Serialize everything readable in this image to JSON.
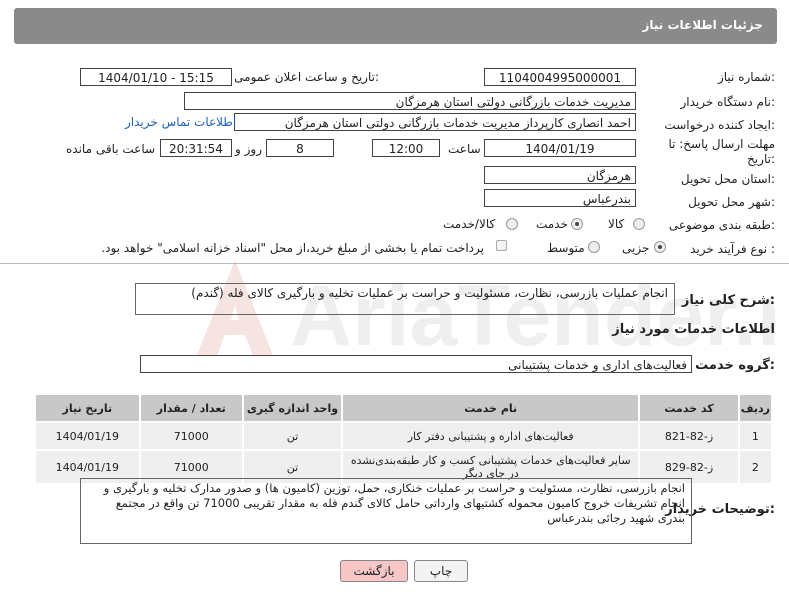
{
  "header": {
    "title": "جزئیات اطلاعات نیاز"
  },
  "fields": {
    "need_number_label": "شماره نیاز:",
    "need_number": "1104004995000001",
    "announce_label": "تاریخ و ساعت اعلان عمومی:",
    "announce_value": "1404/01/10 - 15:15",
    "buyer_label": "نام دستگاه خریدار:",
    "buyer_value": "مدیریت خدمات بازرگانی دولتی استان هرمزگان",
    "creator_label": "ایجاد کننده درخواست:",
    "creator_value": "احمد انصاری کارپرداز مدیریت خدمات بازرگانی دولتی استان هرمزگان",
    "contact_link": "اطلاعات تماس خریدار",
    "deadline_label_1": "مهلت ارسال پاسخ: تا",
    "deadline_label_2": "تاریخ:",
    "deadline_date": "1404/01/19",
    "time_label": "ساعت",
    "deadline_time": "12:00",
    "days_value": "8",
    "days_label": "روز و",
    "remaining_time": "20:31:54",
    "remaining_label": "ساعت باقی مانده",
    "province_label": "استان محل تحویل:",
    "province_value": "هرمزگان",
    "city_label": "شهر محل تحویل:",
    "city_value": "بندرعباس",
    "category_label": "طبقه بندی موضوعی:",
    "category_options": [
      "کالا",
      "خدمت",
      "کالا/خدمت"
    ],
    "category_selected": "خدمت",
    "process_label": "نوع فرآیند خرید :",
    "process_options": [
      "جزیی",
      "متوسط"
    ],
    "process_selected": "جزیی",
    "payment_note": "پرداخت تمام یا بخشی از مبلغ خرید،از محل \"اسناد خزانه اسلامی\" خواهد بود."
  },
  "description": {
    "label": "شرح کلی نیاز:",
    "value": "انجام عملیات بازرسی، نظارت، مسئولیت و حراست بر عملیات تخلیه و بارگیری کالای فله (گندم)"
  },
  "services": {
    "section_title": "اطلاعات خدمات مورد نیاز",
    "group_label": "گروه خدمت:",
    "group_value": "فعالیت‌های اداری و خدمات پشتیبانی",
    "columns": [
      "ردیف",
      "کد خدمت",
      "نام خدمت",
      "واحد اندازه گیری",
      "تعداد / مقدار",
      "تاریخ نیاز"
    ],
    "rows": [
      [
        "1",
        "ز-82-821",
        "فعالیت‌های اداره و پشتیبانی دفتر کار",
        "تن",
        "71000",
        "1404/01/19"
      ],
      [
        "2",
        "ز-82-829",
        "سایر فعالیت‌های خدمات پشتیبانی کسب و کار طبقه‌بندی‌نشده در جای دیگر",
        "تن",
        "71000",
        "1404/01/19"
      ]
    ]
  },
  "buyer_notes": {
    "label": "توضیحات خریدار:",
    "value": "انجام بازرسی، نظارت، مسئولیت و حراست بر عملیات خنکاری، حمل، توزین (کامیون ها) و صدور مدارک تخلیه و بارگیری و انجام تشریفات خروج کامیون محموله کشتیهای وارداتی حامل کالای گندم فله به مقدار تقریبی 71000 تن واقع در مجتمع بندری شهید رجائی بندرعباس"
  },
  "buttons": {
    "print": "چاپ",
    "back": "بازگشت"
  },
  "watermark": {
    "text": "AriaTender.neT"
  },
  "colors": {
    "header_bg": "#8a8a8a",
    "back_button_bg": "#f7c6c6",
    "link": "#1d5fb8"
  }
}
